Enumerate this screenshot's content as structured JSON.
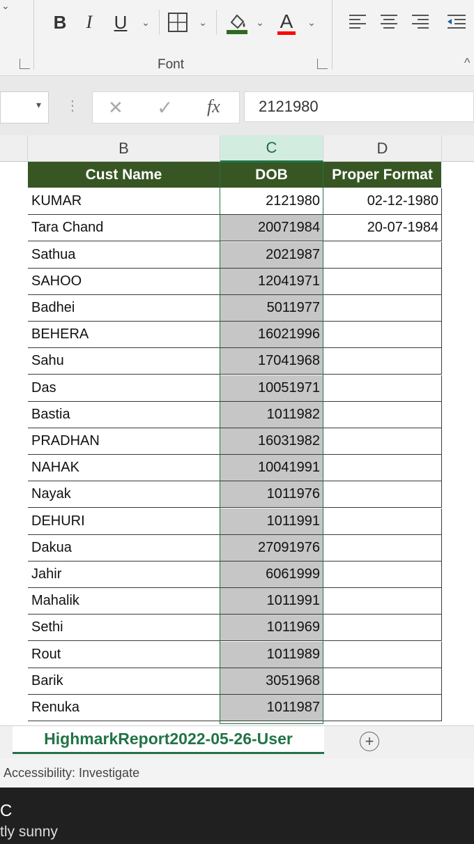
{
  "ribbon": {
    "font_group_label": "Font",
    "font_color_letter": "A",
    "collapse_caret": "⌄"
  },
  "formula_bar": {
    "cancel_symbol": "✕",
    "enter_symbol": "✓",
    "fx_label": "fx",
    "value": "2121980"
  },
  "columns": [
    "B",
    "C",
    "D"
  ],
  "selected_column": "C",
  "table": {
    "headers": [
      "Cust Name",
      "DOB",
      "Proper Format"
    ],
    "rows": [
      [
        "KUMAR",
        "2121980",
        "02-12-1980"
      ],
      [
        "Tara Chand",
        "20071984",
        "20-07-1984"
      ],
      [
        "Sathua",
        "2021987",
        ""
      ],
      [
        "SAHOO",
        "12041971",
        ""
      ],
      [
        "Badhei",
        "5011977",
        ""
      ],
      [
        "BEHERA",
        "16021996",
        ""
      ],
      [
        "Sahu",
        "17041968",
        ""
      ],
      [
        "Das",
        "10051971",
        ""
      ],
      [
        "Bastia",
        "1011982",
        ""
      ],
      [
        "PRADHAN",
        "16031982",
        ""
      ],
      [
        "NAHAK",
        "10041991",
        ""
      ],
      [
        "Nayak",
        "1011976",
        ""
      ],
      [
        "DEHURI",
        "1011991",
        ""
      ],
      [
        "Dakua",
        "27091976",
        ""
      ],
      [
        "Jahir",
        "6061999",
        ""
      ],
      [
        "Mahalik",
        "1011991",
        ""
      ],
      [
        "Sethi",
        "1011969",
        ""
      ],
      [
        "Rout",
        "1011989",
        ""
      ],
      [
        "Barik",
        "3051968",
        ""
      ],
      [
        "Renuka",
        "1011987",
        ""
      ]
    ]
  },
  "sheet_tab": "HighmarkReport2022-05-26-User",
  "status": "Accessibility: Investigate",
  "taskbar": {
    "temp": "C",
    "weather": "tly sunny"
  },
  "colors": {
    "header_fill": "#375623",
    "selection_green": "#217346",
    "selected_cells": "#c6c6c6"
  }
}
